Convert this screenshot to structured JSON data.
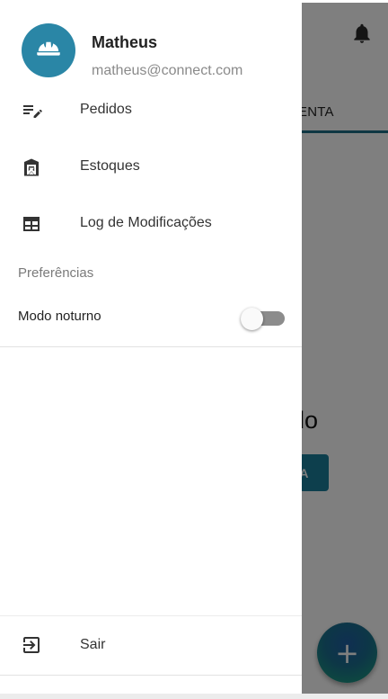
{
  "app": {
    "tab_label": "ENTA",
    "empty_text": "rado",
    "empty_button": "A",
    "fab_label": "+"
  },
  "drawer": {
    "user": {
      "name": "Matheus",
      "email": "matheus@connect.com"
    },
    "nav": [
      {
        "label": "Pedidos",
        "icon": "edit-list-icon"
      },
      {
        "label": "Estoques",
        "icon": "warehouse-icon"
      },
      {
        "label": "Log de Modificações",
        "icon": "table-icon"
      }
    ],
    "preferences": {
      "header": "Preferências",
      "dark_mode_label": "Modo noturno",
      "dark_mode_on": false
    },
    "logout_label": "Sair"
  },
  "colors": {
    "accent": "#2a86a6",
    "tab_underline": "#1f6f86"
  }
}
